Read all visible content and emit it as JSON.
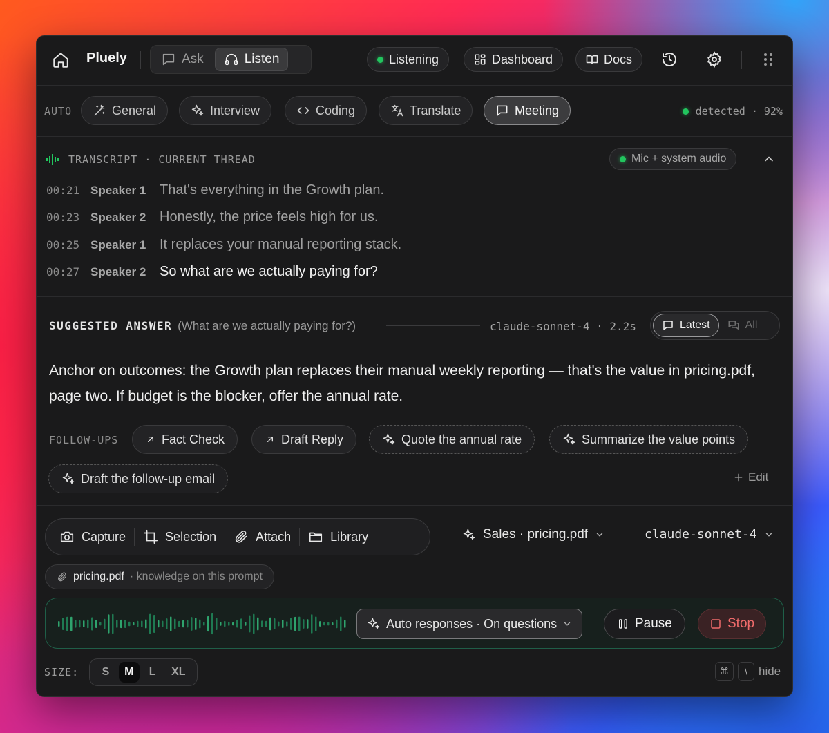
{
  "app": {
    "name": "Pluely",
    "modes": [
      {
        "label": "Ask",
        "active": false,
        "icon": "chat-bubble-icon"
      },
      {
        "label": "Listen",
        "active": true,
        "icon": "headphones-icon"
      }
    ],
    "status": "Listening",
    "dashboard_label": "Dashboard",
    "docs_label": "Docs"
  },
  "mode_row": {
    "auto_label": "AUTO",
    "modes": [
      {
        "label": "General",
        "icon": "magic-wand-icon",
        "active": false
      },
      {
        "label": "Interview",
        "icon": "sparkles-icon",
        "active": false
      },
      {
        "label": "Coding",
        "icon": "code-icon",
        "active": false
      },
      {
        "label": "Translate",
        "icon": "translate-icon",
        "active": false
      },
      {
        "label": "Meeting",
        "icon": "chat-bubble-icon",
        "active": true
      }
    ],
    "detected_text": "detected · 92%"
  },
  "transcript": {
    "header": "TRANSCRIPT · CURRENT THREAD",
    "source": "Mic + system audio",
    "lines": [
      {
        "time": "00:21",
        "speaker": "Speaker 1",
        "text": "That's everything in the Growth plan."
      },
      {
        "time": "00:23",
        "speaker": "Speaker 2",
        "text": "Honestly, the price feels high for us."
      },
      {
        "time": "00:25",
        "speaker": "Speaker 1",
        "text": "It replaces your manual reporting stack."
      },
      {
        "time": "00:27",
        "speaker": "Speaker 2",
        "text": "So what are we actually paying for?"
      }
    ]
  },
  "suggested": {
    "title": "SUGGESTED ANSWER",
    "question": "(What are we actually paying for?)",
    "model_meta": "claude-sonnet-4 · 2.2s",
    "latest_label": "Latest",
    "all_label": "All",
    "answer": "Anchor on outcomes: the Growth plan replaces their manual weekly reporting — that's the value in pricing.pdf, page two. If budget is the blocker, offer the annual rate."
  },
  "followups": {
    "label": "FOLLOW-UPS",
    "items": [
      {
        "label": "Fact Check",
        "icon": "arrow-up-right-icon"
      },
      {
        "label": "Draft Reply",
        "icon": "arrow-up-right-icon"
      },
      {
        "label": "Quote the annual rate",
        "icon": "sparkles-icon"
      },
      {
        "label": "Summarize the value points",
        "icon": "sparkles-icon"
      },
      {
        "label": "Draft the follow-up email",
        "icon": "sparkles-icon"
      }
    ],
    "edit_label": "Edit"
  },
  "tools": {
    "items": [
      {
        "label": "Capture",
        "icon": "camera-icon"
      },
      {
        "label": "Selection",
        "icon": "crop-icon"
      },
      {
        "label": "Attach",
        "icon": "paperclip-icon"
      },
      {
        "label": "Library",
        "icon": "folder-icon"
      }
    ],
    "context": "Sales · pricing.pdf",
    "model": "claude-sonnet-4"
  },
  "attachment": {
    "name": "pricing.pdf",
    "note": "· knowledge on this prompt"
  },
  "recorder": {
    "auto_responses": "Auto responses · On questions",
    "pause_label": "Pause",
    "stop_label": "Stop",
    "accent": "#22c55e"
  },
  "size": {
    "label": "SIZE:",
    "options": [
      "S",
      "M",
      "L",
      "XL"
    ],
    "selected": "M"
  },
  "shortcut": {
    "keys": [
      "⌘",
      "\\"
    ],
    "label": "hide"
  }
}
